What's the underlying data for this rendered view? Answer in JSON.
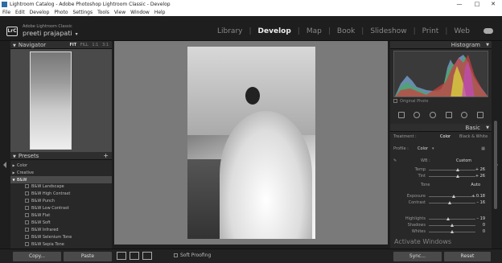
{
  "window": {
    "title": "Lightroom Catalog - Adobe Photoshop Lightroom Classic - Develop",
    "min": "—",
    "max": "□",
    "close": "✕"
  },
  "menu": [
    "File",
    "Edit",
    "Develop",
    "Photo",
    "Settings",
    "Tools",
    "View",
    "Window",
    "Help"
  ],
  "identity": {
    "logo": "LrC",
    "product": "Adobe Lightroom Classic",
    "user": "preeti prajapati",
    "dropdown": "▾"
  },
  "modules": [
    "Library",
    "Develop",
    "Map",
    "Book",
    "Slideshow",
    "Print",
    "Web"
  ],
  "navigator": {
    "title": "Navigator",
    "options": [
      "FIT",
      "FILL",
      "1:1",
      "3:1"
    ]
  },
  "presets": {
    "title": "Presets",
    "add": "+",
    "items": [
      {
        "label": "Color",
        "kind": "group",
        "expanded": false
      },
      {
        "label": "Creative",
        "kind": "group",
        "expanded": false
      },
      {
        "label": "B&W",
        "kind": "group",
        "expanded": true,
        "selected": true
      },
      {
        "label": "B&W Landscape",
        "kind": "item"
      },
      {
        "label": "B&W High Contrast",
        "kind": "item"
      },
      {
        "label": "B&W Punch",
        "kind": "item"
      },
      {
        "label": "B&W Low Contrast",
        "kind": "item"
      },
      {
        "label": "B&W Flat",
        "kind": "item"
      },
      {
        "label": "B&W Soft",
        "kind": "item"
      },
      {
        "label": "B&W Infrared",
        "kind": "item"
      },
      {
        "label": "B&W Selenium Tone",
        "kind": "item"
      },
      {
        "label": "B&W Sepia Tone",
        "kind": "item"
      }
    ]
  },
  "histogram": {
    "title": "Histogram",
    "original_photo": "Original Photo"
  },
  "basic": {
    "title": "Basic",
    "treatment_label": "Treatment :",
    "treatment_color": "Color",
    "treatment_bw": "Black & White",
    "profile_label": "Profile :",
    "profile_value": "Color",
    "wb_label": "WB :",
    "wb_value": "Custom",
    "tone_label": "Tone",
    "tone_auto": "Auto",
    "sliders": [
      {
        "label": "Temp",
        "value": "+ 26",
        "pos": 0.62
      },
      {
        "label": "Tint",
        "value": "+ 26",
        "pos": 0.62
      },
      {
        "label": "Exposure",
        "value": "+ 0.18",
        "pos": 0.53
      },
      {
        "label": "Contrast",
        "value": "– 16",
        "pos": 0.45
      },
      {
        "label": "Highlights",
        "value": "– 19",
        "pos": 0.42
      },
      {
        "label": "Shadows",
        "value": "0",
        "pos": 0.5
      },
      {
        "label": "Whites",
        "value": "0",
        "pos": 0.5
      }
    ]
  },
  "bottom": {
    "copy": "Copy...",
    "paste": "Paste",
    "soft_proofing": "Soft Proofing",
    "sync": "Sync...",
    "reset": "Reset"
  },
  "watermark": "Activate Windows"
}
